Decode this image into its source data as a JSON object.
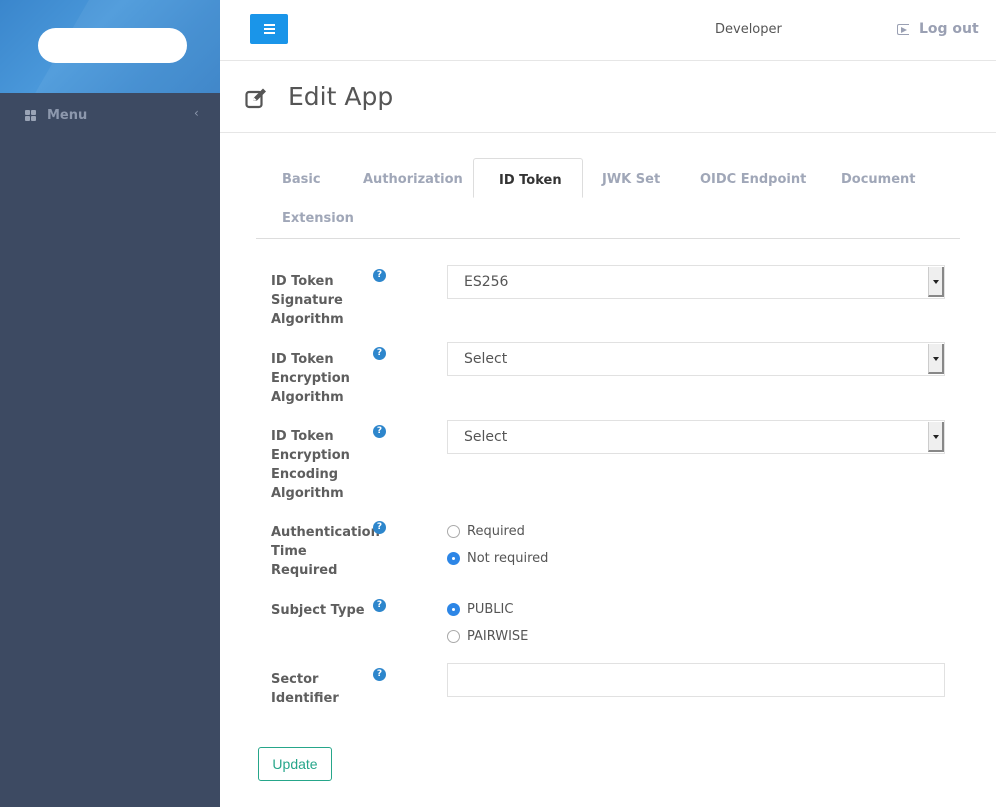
{
  "sidebar": {
    "menu_label": "Menu",
    "menu_icon": "grid-icon",
    "collapse_icon": "chevron-left-icon",
    "collapse_glyph": "‹"
  },
  "topbar": {
    "hamburger_icon": "hamburger-icon",
    "user_label": "Developer",
    "logout_label": "Log out",
    "logout_icon": "sign-out-icon"
  },
  "page": {
    "title": "Edit App",
    "title_icon": "edit-icon"
  },
  "tabs": [
    {
      "label": "Basic",
      "active": false
    },
    {
      "label": "Authorization",
      "active": false
    },
    {
      "label": "ID Token",
      "active": true
    },
    {
      "label": "JWK Set",
      "active": false
    },
    {
      "label": "OIDC Endpoint",
      "active": false
    },
    {
      "label": "Document",
      "active": false
    },
    {
      "label": "Extension",
      "active": false
    }
  ],
  "form": {
    "help_glyph": "?",
    "signature_algorithm": {
      "label": "ID Token Signature Algorithm",
      "value": "ES256"
    },
    "encryption_algorithm": {
      "label": "ID Token Encryption Algorithm",
      "value": "Select"
    },
    "encryption_encoding_algorithm": {
      "label": "ID Token Encryption Encoding Algorithm",
      "value": "Select"
    },
    "auth_time_required": {
      "label": "Authentication Time Required",
      "options": [
        {
          "label": "Required",
          "checked": false
        },
        {
          "label": "Not required",
          "checked": true
        }
      ]
    },
    "subject_type": {
      "label": "Subject Type",
      "options": [
        {
          "label": "PUBLIC",
          "checked": true
        },
        {
          "label": "PAIRWISE",
          "checked": false
        }
      ]
    },
    "sector_identifier": {
      "label": "Sector Identifier",
      "value": ""
    },
    "update_label": "Update"
  },
  "colors": {
    "sidebar_bg": "#3d4a62",
    "brand_blue": "#1a95e9",
    "help_blue": "#2d86cc",
    "update_green": "#26a68a"
  }
}
